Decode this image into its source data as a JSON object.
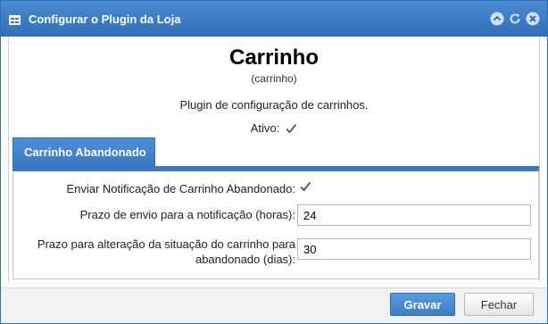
{
  "window": {
    "title": "Configurar o Plugin da Loja"
  },
  "header": {
    "title": "Carrinho",
    "subtitle": "(carrinho)",
    "description": "Plugin de configuração de carrinhos.",
    "active_label": "Ativo:",
    "active_checked": true
  },
  "tab": {
    "label": "Carrinho Abandonado"
  },
  "form": {
    "notify_label": "Enviar Notificação de Carrinho Abandonado:",
    "notify_checked": true,
    "deadline_label": "Prazo de envio para a notificação (horas):",
    "deadline_value": "24",
    "status_label_line1": "Prazo para alteração da situação do carrinho para",
    "status_label_line2": "abandonado (dias):",
    "status_value": "30"
  },
  "footer": {
    "save_label": "Gravar",
    "close_label": "Fechar"
  },
  "colors": {
    "accent": "#2f6fb5",
    "tab": "#3a78c2",
    "footer": "#f2f2f2"
  },
  "icons": {
    "window": "form-window-icon",
    "collapse": "collapse-icon",
    "refresh": "refresh-icon",
    "close": "close-icon",
    "check": "check-icon"
  }
}
